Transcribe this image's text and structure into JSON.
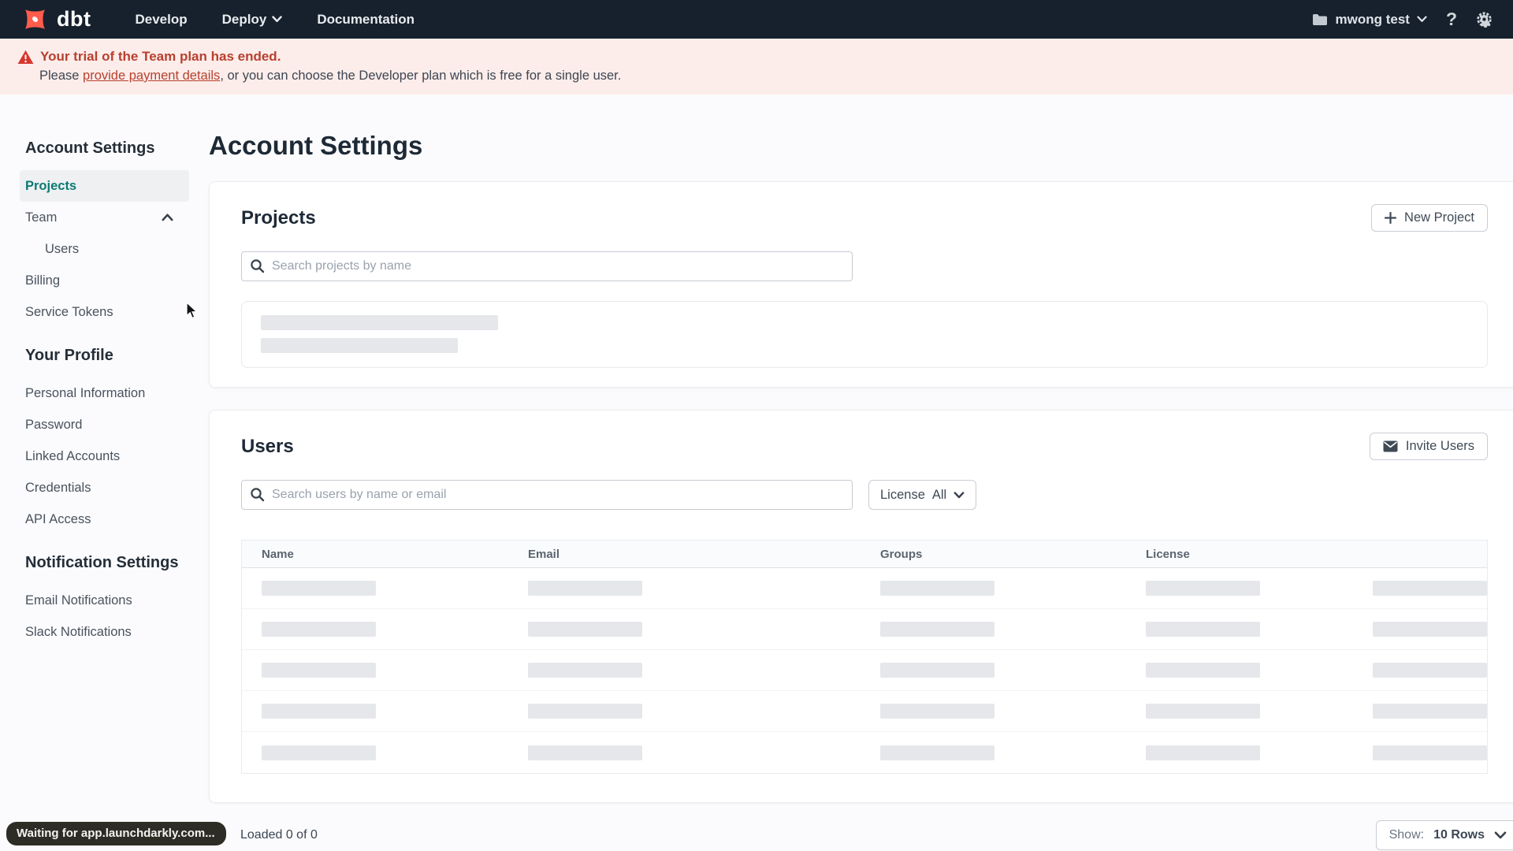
{
  "colors": {
    "nav_bg": "#16212d",
    "brand_orange": "#ff5c4c",
    "active_teal": "#0d7a73",
    "banner_bg": "#fcedea",
    "banner_red": "#b8402f",
    "skeleton_gray": "#e5e7ea"
  },
  "topnav": {
    "logo_text": "dbt",
    "develop": "Develop",
    "deploy": "Deploy",
    "documentation": "Documentation",
    "account_name": "mwong test"
  },
  "banner": {
    "title": "Your trial of the Team plan has ended.",
    "body_prefix": "Please ",
    "link_text": "provide payment details",
    "body_suffix": ", or you can choose the Developer plan which is free for a single user."
  },
  "sidebar": {
    "header": "Account Settings",
    "projects": "Projects",
    "team": "Team",
    "users": "Users",
    "billing": "Billing",
    "service_tokens": "Service Tokens",
    "profile_header": "Your Profile",
    "personal_information": "Personal Information",
    "password": "Password",
    "linked_accounts": "Linked Accounts",
    "credentials": "Credentials",
    "api_access": "API Access",
    "notifications_header": "Notification Settings",
    "email_notifications": "Email Notifications",
    "slack_notifications": "Slack Notifications"
  },
  "main": {
    "page_title": "Account Settings",
    "projects_section": {
      "title": "Projects",
      "new_project_button": "New Project",
      "search_placeholder": "Search projects by name",
      "loading_skeleton_rows": 2
    },
    "users_section": {
      "title": "Users",
      "invite_button": "Invite Users",
      "search_placeholder": "Search users by name or email",
      "license_filter_label": "License",
      "license_filter_value": "All",
      "table": {
        "columns": [
          "Name",
          "Email",
          "Groups",
          "License"
        ],
        "skeleton_row_count": 5
      },
      "footer": {
        "loaded_text": "Loaded 0 of 0",
        "show_label": "Show:",
        "show_value": "10 Rows"
      }
    }
  },
  "status_tooltip": {
    "text": "Waiting for app.launchdarkly.com..."
  }
}
